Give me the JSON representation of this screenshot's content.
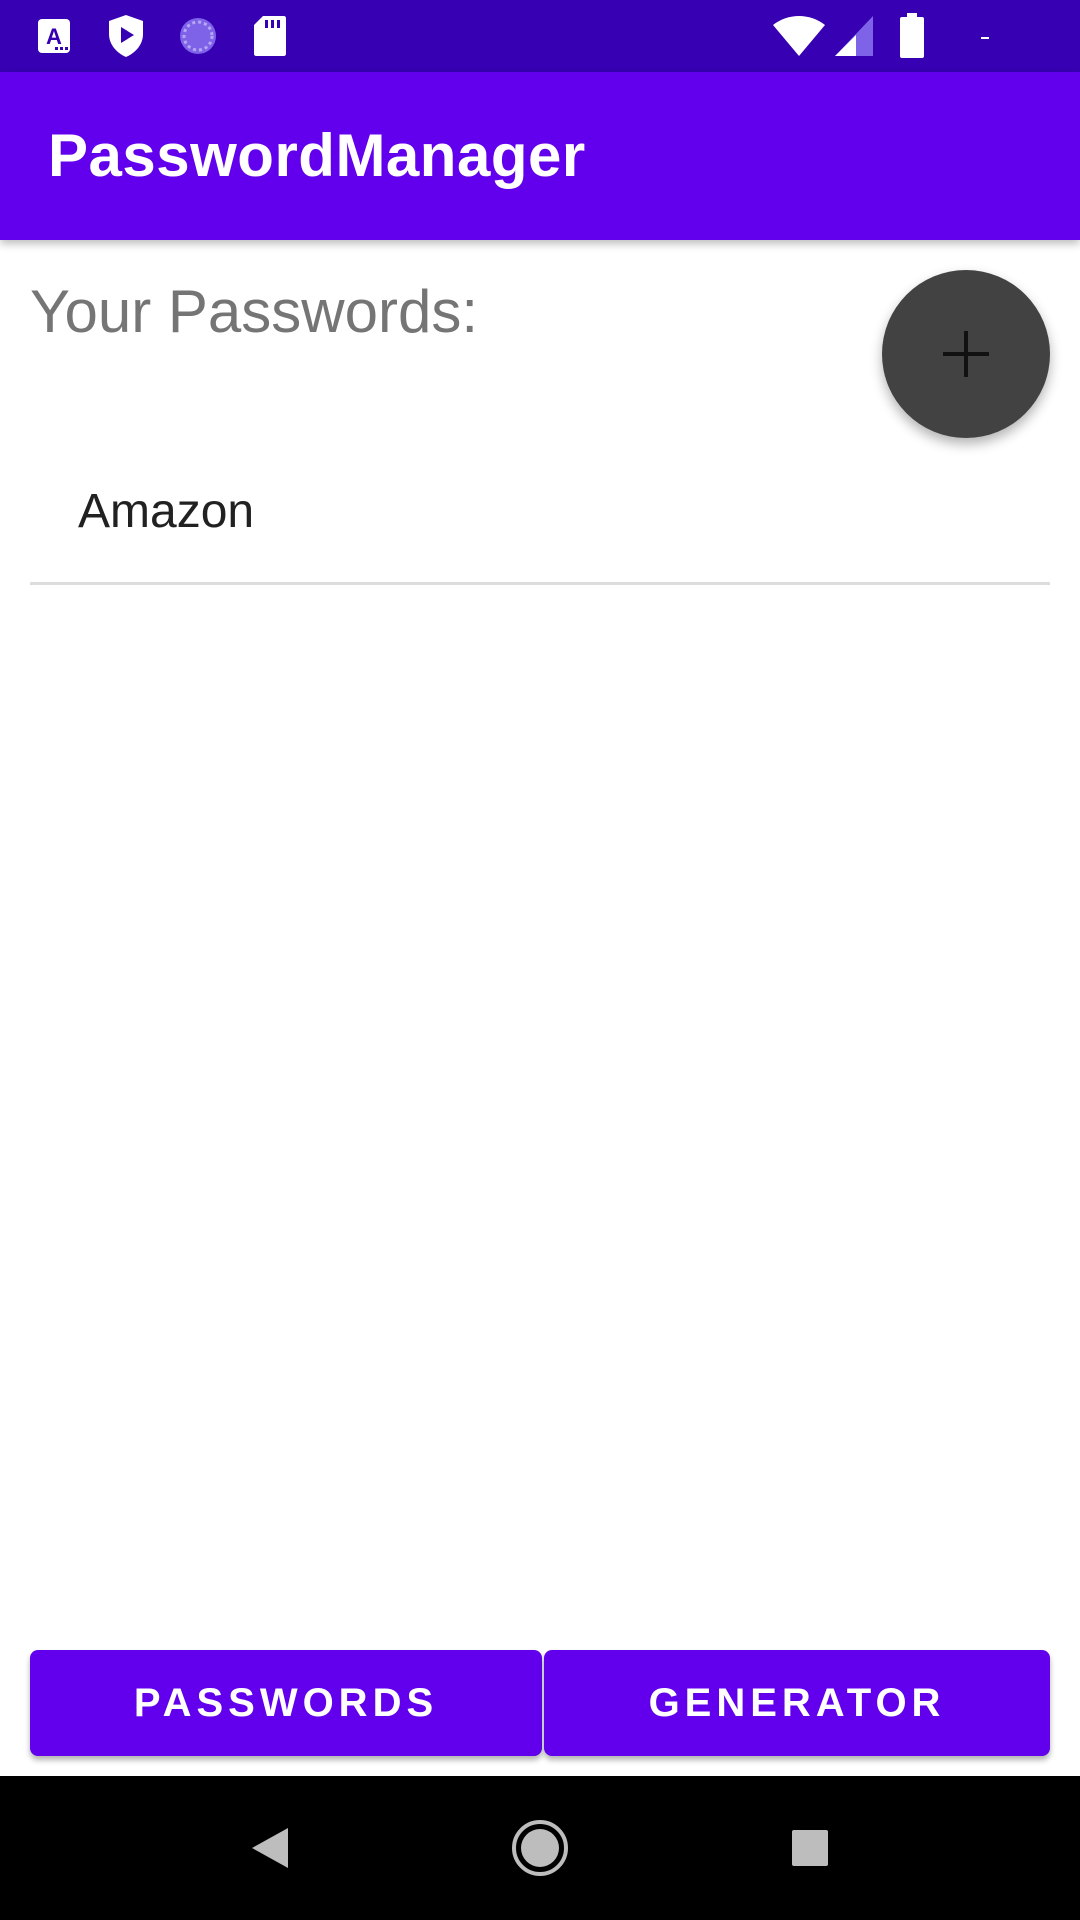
{
  "status_bar": {
    "left_icons": [
      "app-a-icon",
      "shield-play-icon",
      "loading-icon",
      "sd-card-icon"
    ],
    "right_icons": [
      "wifi-icon",
      "cell-signal-icon",
      "battery-icon"
    ],
    "background": "#3700B3"
  },
  "app_bar": {
    "title": "PasswordManager",
    "background": "#6200EE"
  },
  "main": {
    "heading": "Your Passwords:",
    "fab_icon": "plus-icon",
    "items": [
      {
        "label": "Amazon"
      }
    ]
  },
  "bottom_buttons": {
    "passwords_label": "PASSWORDS",
    "generator_label": "GENERATOR",
    "background": "#6200EE"
  },
  "nav_bar": {
    "icons": [
      "back-icon",
      "home-icon",
      "recents-icon"
    ]
  }
}
